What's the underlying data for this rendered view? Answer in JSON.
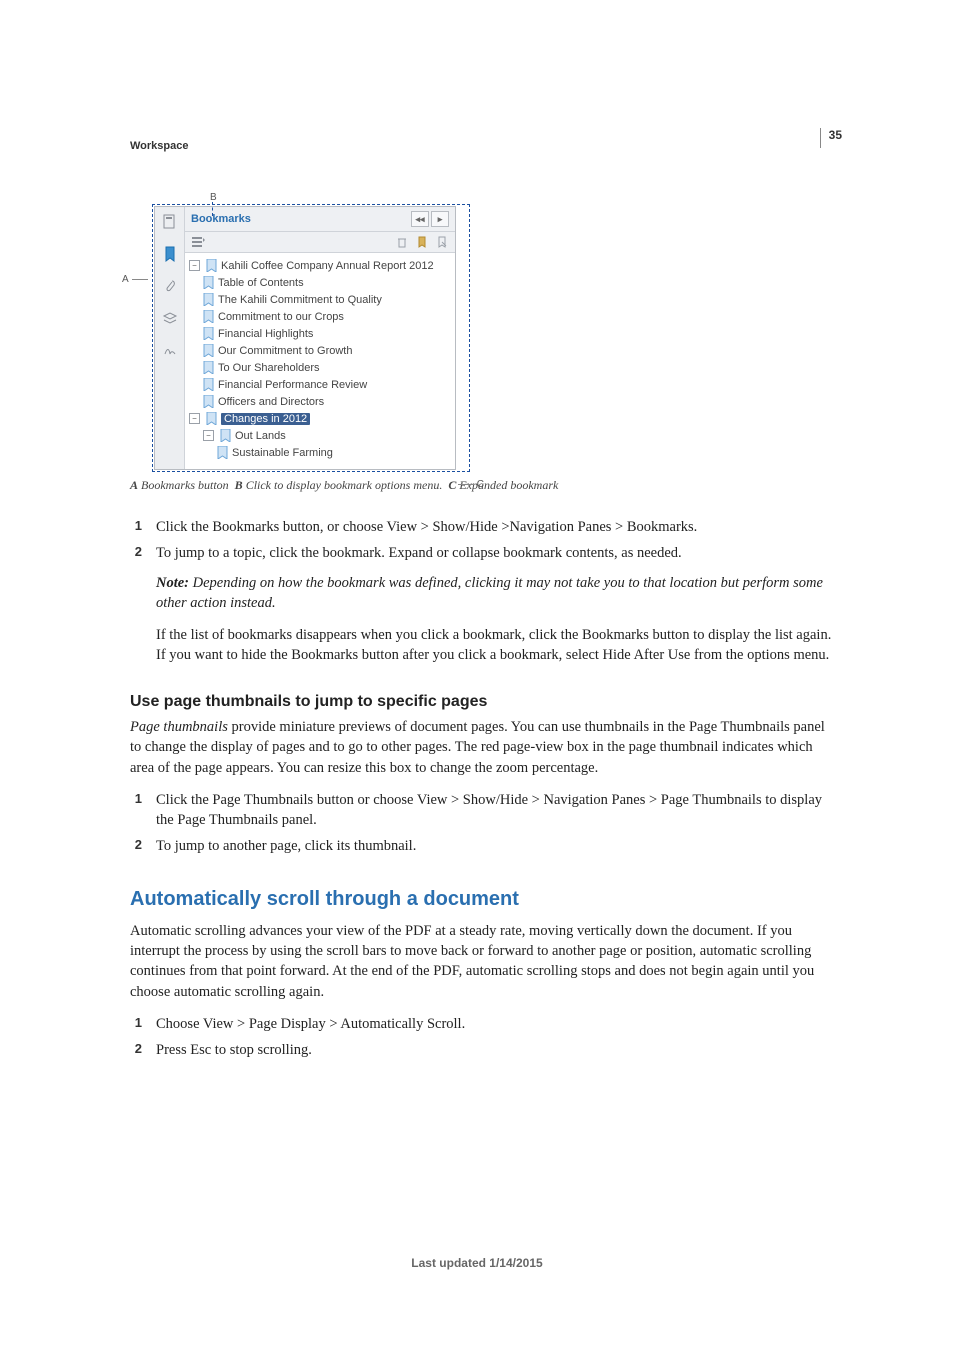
{
  "pageNumber": "35",
  "sectionLabel": "Workspace",
  "figure": {
    "calloutA": "A",
    "calloutB": "B",
    "calloutC": "C",
    "panelTitle": "Bookmarks",
    "tree": {
      "root": "Kahili Coffee Company Annual Report 2012",
      "children": [
        "Table of Contents",
        "The Kahili Commitment to Quality",
        "Commitment to our Crops",
        "Financial Highlights",
        "Our Commitment to Growth",
        "To Our Shareholders",
        "Financial Performance Review",
        "Officers and Directors"
      ],
      "selected": "Changes in 2012",
      "sub1": "Out Lands",
      "sub2": "Sustainable Farming"
    }
  },
  "caption": {
    "a": "Bookmarks button",
    "b": "Click to display bookmark options menu.",
    "c": "Expanded bookmark"
  },
  "listA": {
    "n1": "1",
    "t1": "Click the Bookmarks button, or choose View > Show/Hide >Navigation Panes > Bookmarks.",
    "n2": "2",
    "t2": "To jump to a topic, click the bookmark. Expand or collapse bookmark contents, as needed."
  },
  "note": {
    "label": "Note:",
    "text": "Depending on how the bookmark was defined, clicking it may not take you to that location but perform some other action instead."
  },
  "paraAfterNote": "If the list of bookmarks disappears when you click a bookmark, click the Bookmarks button to display the list again. If you want to hide the Bookmarks button after you click a bookmark, select Hide After Use from the options menu.",
  "subhead1": "Use page thumbnails to jump to specific pages",
  "thumbIntroPrefix": "Page thumbnails",
  "thumbIntroRest": " provide miniature previews of document pages. You can use thumbnails in the Page Thumbnails panel to change the display of pages and to go to other pages. The red page-view box in the page thumbnail indicates which area of the page appears. You can resize this box to change the zoom percentage.",
  "listB": {
    "n1": "1",
    "t1": "Click the Page Thumbnails button or choose View > Show/Hide > Navigation Panes > Page Thumbnails to display the Page Thumbnails panel.",
    "n2": "2",
    "t2": "To jump to another page, click its thumbnail."
  },
  "head2": "Automatically scroll through a document",
  "autoscrollBody": "Automatic scrolling advances your view of the PDF at a steady rate, moving vertically down the document. If you interrupt the process by using the scroll bars to move back or forward to another page or position, automatic scrolling continues from that point forward. At the end of the PDF, automatic scrolling stops and does not begin again until you choose automatic scrolling again.",
  "listC": {
    "n1": "1",
    "t1": "Choose View > Page Display > Automatically Scroll.",
    "n2": "2",
    "t2": "Press Esc to stop scrolling."
  },
  "footer": "Last updated 1/14/2015"
}
